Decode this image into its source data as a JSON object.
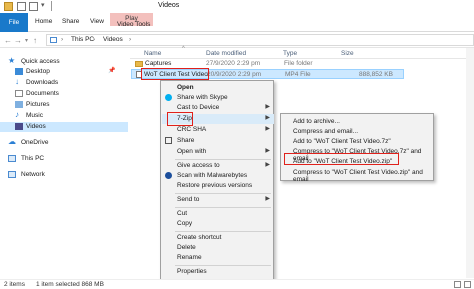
{
  "window": {
    "title": "Videos"
  },
  "ribbon": {
    "tabs": {
      "file": "File",
      "home": "Home",
      "share": "Share",
      "view": "View",
      "play": "Play",
      "video_tools": "Video Tools"
    }
  },
  "address": {
    "this_pc": "This PC",
    "videos": "Videos"
  },
  "columns": {
    "name": "Name",
    "date": "Date modified",
    "type": "Type",
    "size": "Size"
  },
  "nav": {
    "items": [
      {
        "label": "Quick access",
        "icon": "star-icon"
      },
      {
        "label": "Desktop",
        "icon": "desktop-icon"
      },
      {
        "label": "Downloads",
        "icon": "download-icon"
      },
      {
        "label": "Documents",
        "icon": "document-icon"
      },
      {
        "label": "Pictures",
        "icon": "pictures-icon"
      },
      {
        "label": "Music",
        "icon": "music-icon"
      },
      {
        "label": "Videos",
        "icon": "video-icon"
      },
      {
        "label": "OneDrive",
        "icon": "cloud-icon"
      },
      {
        "label": "This PC",
        "icon": "computer-icon"
      },
      {
        "label": "Network",
        "icon": "network-icon"
      }
    ]
  },
  "files": [
    {
      "name": "Captures",
      "date": "27/9/2020 2:29 pm",
      "type": "File folder",
      "size": ""
    },
    {
      "name": "WoT Client Test Video",
      "date": "20/9/2020 2:29 pm",
      "type": "MP4 File",
      "size": "888,852 KB"
    }
  ],
  "context_menu": {
    "open": "Open",
    "share_skype": "Share with Skype",
    "cast": "Cast to Device",
    "seven_zip": "7-Zip",
    "crc_sha": "CRC SHA",
    "share": "Share",
    "open_with": "Open with",
    "give_access": "Give access to",
    "malwarebytes": "Scan with Malwarebytes",
    "restore": "Restore previous versions",
    "send_to": "Send to",
    "cut": "Cut",
    "copy": "Copy",
    "create_shortcut": "Create shortcut",
    "delete": "Delete",
    "rename": "Rename",
    "properties": "Properties"
  },
  "submenu": {
    "add_archive": "Add to archive...",
    "compress_email": "Compress and email...",
    "add_7z": "Add to \"WoT Client Test Video.7z\"",
    "compress_7z_email": "Compress to \"WoT Client Test Video.7z\" and email",
    "add_zip": "Add to \"WoT Client Test Video.zip\"",
    "compress_zip_email": "Compress to \"WoT Client Test Video.zip\" and email"
  },
  "status": {
    "items": "2 items",
    "selected": "1 item selected 868 MB"
  },
  "colors": {
    "file_tab": "#1979ca",
    "play_band": "#f3c0bd",
    "selection": "#cce8ff",
    "highlight_box": "#e0211b"
  }
}
